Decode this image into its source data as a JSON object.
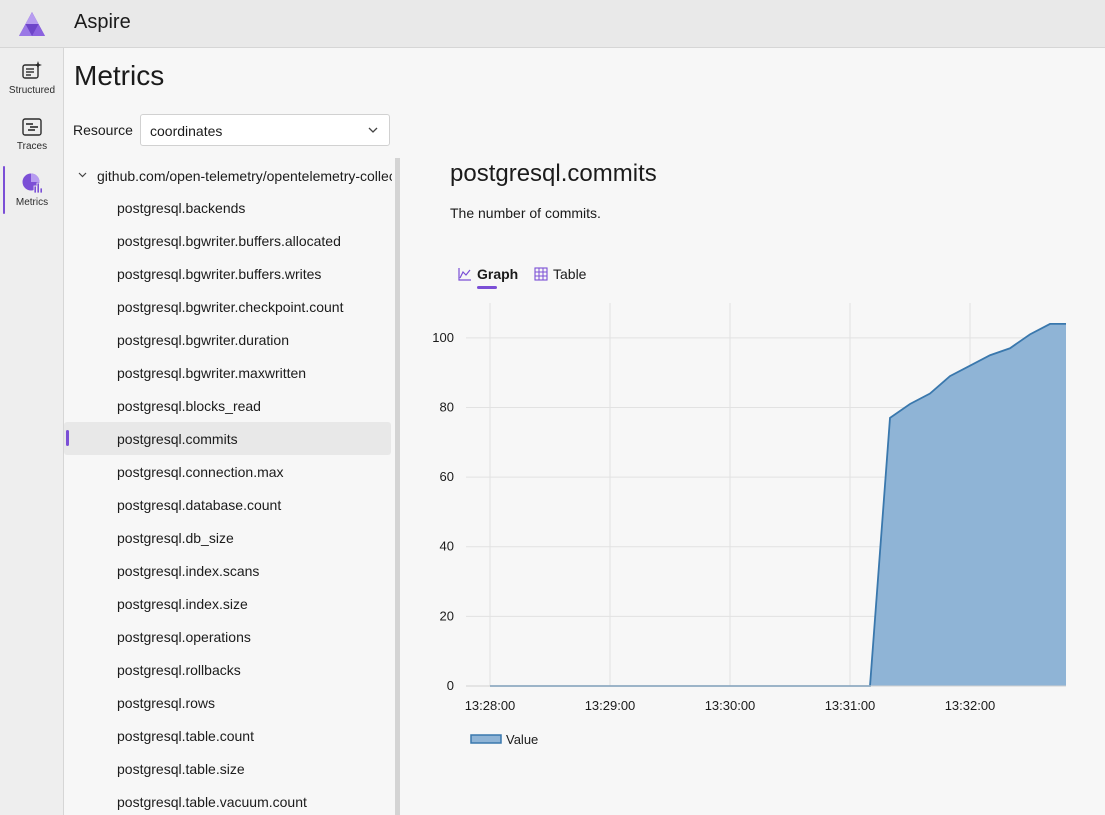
{
  "app": {
    "title": "Aspire",
    "logo_icon": "aspire-logo-icon"
  },
  "nav": [
    {
      "label": "Structured",
      "icon": "structured-logs-icon",
      "active": false
    },
    {
      "label": "Traces",
      "icon": "traces-icon",
      "active": false
    },
    {
      "label": "Metrics",
      "icon": "metrics-icon",
      "active": true
    }
  ],
  "page": {
    "title": "Metrics"
  },
  "resource": {
    "label": "Resource",
    "value": "coordinates"
  },
  "tree": {
    "root": "github.com/open-telemetry/opentelemetry-collector",
    "items": [
      "postgresql.backends",
      "postgresql.bgwriter.buffers.allocated",
      "postgresql.bgwriter.buffers.writes",
      "postgresql.bgwriter.checkpoint.count",
      "postgresql.bgwriter.duration",
      "postgresql.bgwriter.maxwritten",
      "postgresql.blocks_read",
      "postgresql.commits",
      "postgresql.connection.max",
      "postgresql.database.count",
      "postgresql.db_size",
      "postgresql.index.scans",
      "postgresql.index.size",
      "postgresql.operations",
      "postgresql.rollbacks",
      "postgresql.rows",
      "postgresql.table.count",
      "postgresql.table.size",
      "postgresql.table.vacuum.count"
    ],
    "selected": "postgresql.commits"
  },
  "detail": {
    "title": "postgresql.commits",
    "description": "The number of commits.",
    "tabs": {
      "graph": "Graph",
      "table": "Table"
    }
  },
  "colors": {
    "accent": "#7b4fd6",
    "area_fill": "#8fb4d6",
    "area_line": "#3a78ad"
  },
  "chart_data": {
    "type": "area",
    "x": [
      "13:28:00",
      "13:29:00",
      "13:30:00",
      "13:31:00",
      "13:31:10",
      "13:31:20",
      "13:31:30",
      "13:31:40",
      "13:31:50",
      "13:32:00",
      "13:32:10",
      "13:32:20",
      "13:32:30",
      "13:32:40",
      "13:32:50",
      "13:33:00"
    ],
    "series": [
      {
        "name": "Value",
        "values": [
          0,
          0,
          0,
          0,
          0,
          77,
          81,
          84,
          89,
          92,
          95,
          97,
          101,
          104,
          104,
          104
        ]
      }
    ],
    "xticks": [
      "13:28:00",
      "13:29:00",
      "13:30:00",
      "13:31:00",
      "13:32:00"
    ],
    "yticks": [
      0,
      20,
      40,
      60,
      80,
      100
    ],
    "ylim": [
      0,
      110
    ],
    "grid": true,
    "legend": "bottom-left"
  }
}
